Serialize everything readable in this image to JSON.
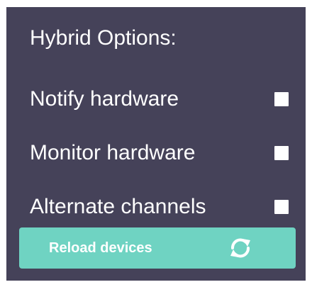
{
  "panel": {
    "title": "Hybrid Options:",
    "options": [
      {
        "label": "Notify hardware",
        "checked": false
      },
      {
        "label": "Monitor hardware",
        "checked": false
      },
      {
        "label": "Alternate channels",
        "checked": false
      }
    ],
    "reload_button": {
      "label": "Reload devices",
      "icon": "refresh-icon"
    }
  },
  "colors": {
    "panel_bg": "#454259",
    "text": "#ffffff",
    "button_bg": "#6fd3c2",
    "checkbox": "#ffffff"
  }
}
